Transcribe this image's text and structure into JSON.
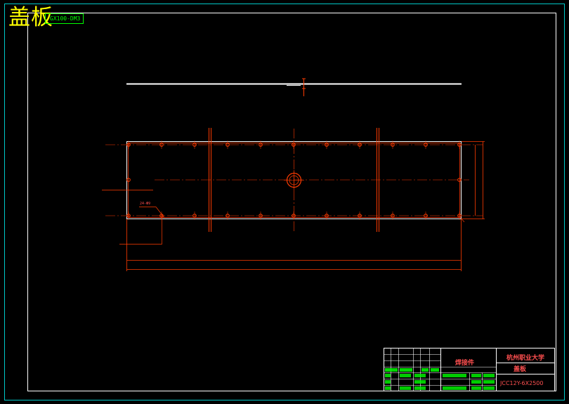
{
  "drawing": {
    "title": "盖板",
    "code": "GX100-DM3"
  },
  "title_block": {
    "assembly": "焊接件",
    "school": "杭州职业大学",
    "part_name": "盖板",
    "drawing_no": "JCC12Y-6X2500"
  },
  "dimensions": {
    "hole_note": "24-Φ9"
  },
  "colors": {
    "background": "#000000",
    "frame": "#00c8c8",
    "inner_frame": "#ffffff",
    "geometry": "#ff3b00",
    "title_text": "#ffff00",
    "table_green": "#00ff00",
    "table_red": "#ff5050"
  }
}
